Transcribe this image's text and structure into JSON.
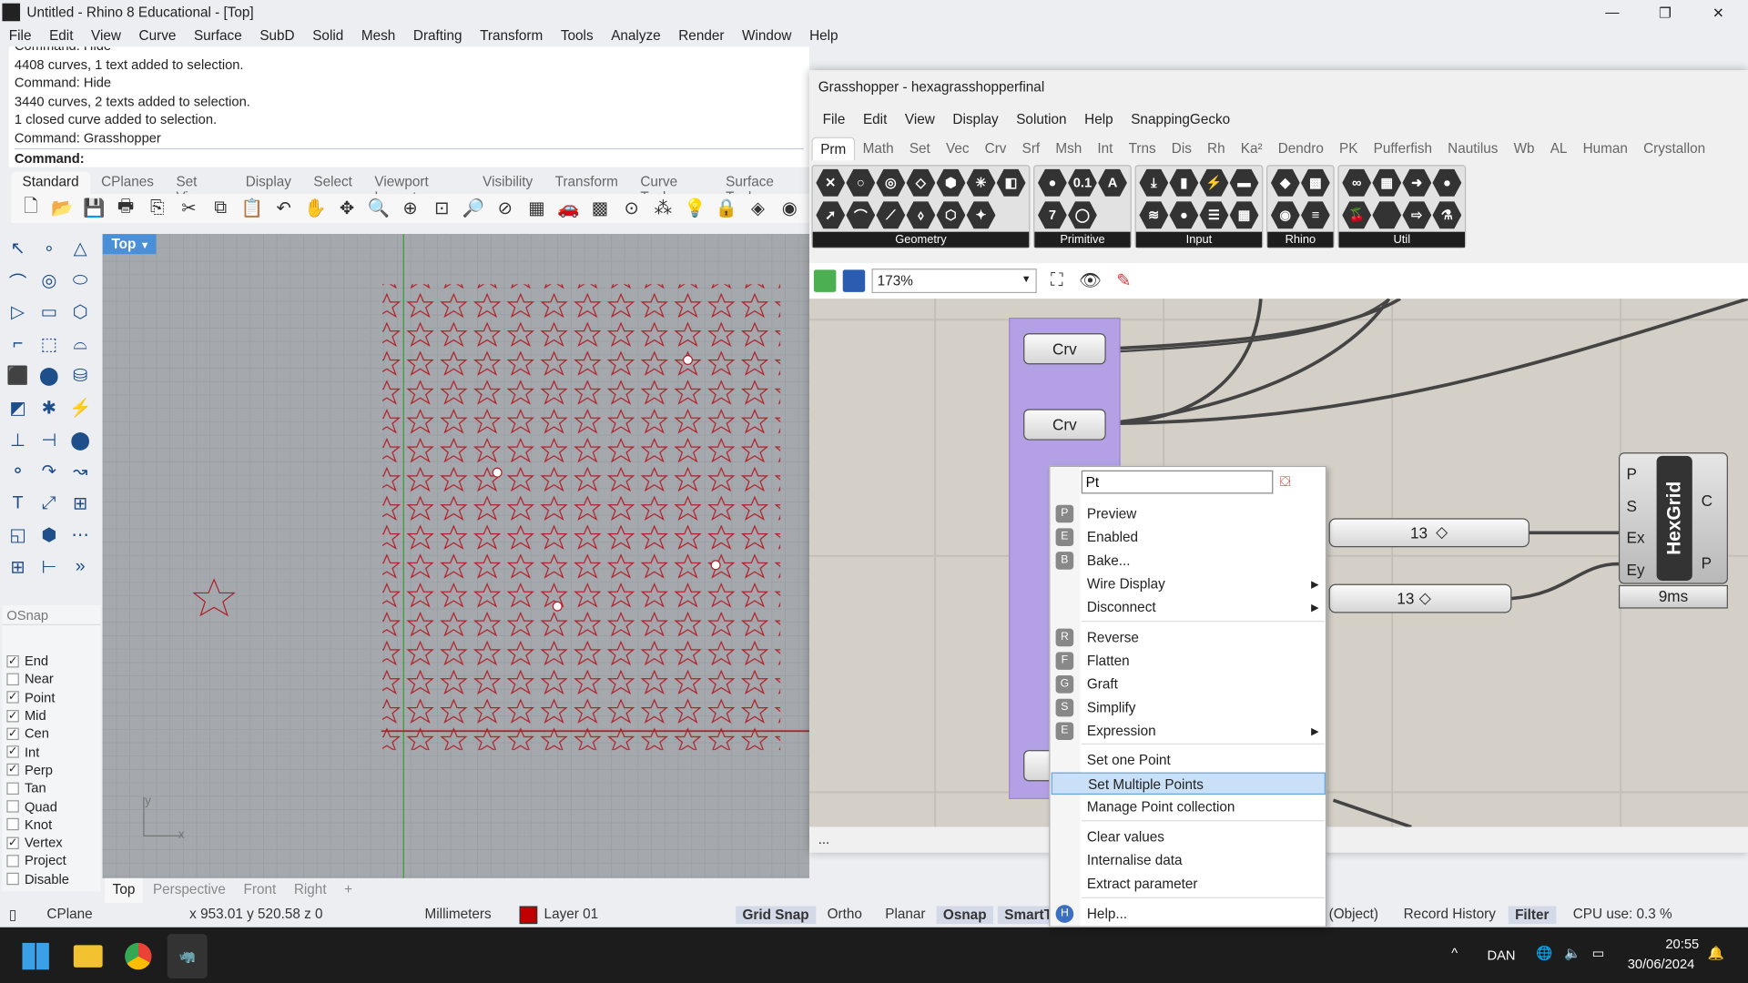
{
  "window": {
    "title": "Untitled - Rhino 8 Educational - [Top]"
  },
  "menu": [
    "File",
    "Edit",
    "View",
    "Curve",
    "Surface",
    "SubD",
    "Solid",
    "Mesh",
    "Drafting",
    "Transform",
    "Tools",
    "Analyze",
    "Render",
    "Window",
    "Help"
  ],
  "command_history": [
    "Command: Hide",
    "4408 curves, 1 text added to selection.",
    "Command: Hide",
    "3440 curves, 2 texts added to selection.",
    "1 closed curve added to selection.",
    "Command: Grasshopper"
  ],
  "command_prompt": "Command:",
  "toolbar_tabs": [
    "Standard",
    "CPlanes",
    "Set View",
    "Display",
    "Select",
    "Viewport Layout",
    "Visibility",
    "Transform",
    "Curve Tools",
    "Surface Tools"
  ],
  "toolbar_icons": [
    "new-file-icon",
    "open-icon",
    "save-icon",
    "print-icon",
    "export-icon",
    "cut-icon",
    "copy-icon",
    "paste-icon",
    "undo-icon",
    "pan-icon",
    "rotate-view-icon",
    "zoom-icon",
    "zoom-window-icon",
    "zoom-extents-icon",
    "zoom-selected-icon",
    "zoom-dynamic-icon",
    "four-view-icon",
    "car-icon",
    "grid-icon",
    "osnap-icon",
    "points-icon",
    "light-icon",
    "lock-icon",
    "material-icon",
    "color-wheel-icon"
  ],
  "toolbox_glyphs": [
    "↖",
    "∘",
    "△",
    "⌒",
    "◎",
    "⬭",
    "▷",
    "▭",
    "⬡",
    "⌐",
    "⬚",
    "⌓",
    "⬛",
    "⬤",
    "⛁",
    "◩",
    "✱",
    "⚡",
    "⊥",
    "⊣",
    "⬤",
    "⚬",
    "↷",
    "↝",
    "T",
    "⤢",
    "⊞",
    "◱",
    "⬢",
    "⋯",
    "⊞",
    "⊢",
    "»"
  ],
  "osnap": {
    "title": "OSnap",
    "items": [
      {
        "label": "End",
        "checked": true
      },
      {
        "label": "Near",
        "checked": false
      },
      {
        "label": "Point",
        "checked": true
      },
      {
        "label": "Mid",
        "checked": true
      },
      {
        "label": "Cen",
        "checked": true
      },
      {
        "label": "Int",
        "checked": true
      },
      {
        "label": "Perp",
        "checked": true
      },
      {
        "label": "Tan",
        "checked": false
      },
      {
        "label": "Quad",
        "checked": false
      },
      {
        "label": "Knot",
        "checked": false
      },
      {
        "label": "Vertex",
        "checked": true
      },
      {
        "label": "Project",
        "checked": false
      },
      {
        "label": "Disable",
        "checked": false
      }
    ]
  },
  "viewport": {
    "label": "Top",
    "axis_x": "x",
    "axis_y": "y"
  },
  "viewport_tabs": [
    "Top",
    "Perspective",
    "Front",
    "Right"
  ],
  "statusbar": {
    "cplane": "CPlane",
    "coords": "x 953.01  y 520.58  z 0",
    "units": "Millimeters",
    "layer": "Layer 01",
    "layer_color": "#c00000",
    "grid_snap": "Grid Snap",
    "ortho": "Ortho",
    "planar": "Planar",
    "osnap": "Osnap",
    "smart": "SmartTrack",
    "object": "(Object)",
    "record_history": "Record History",
    "filter": "Filter",
    "cpu": "CPU use: 0.3 %"
  },
  "taskbar": {
    "lang": "DAN",
    "time": "20:55",
    "date": "30/06/2024"
  },
  "grasshopper": {
    "title": "Grasshopper - hexagrasshopperfinal",
    "menu": [
      "File",
      "Edit",
      "View",
      "Display",
      "Solution",
      "Help",
      "SnappingGecko"
    ],
    "tabs": [
      "Prm",
      "Math",
      "Set",
      "Vec",
      "Crv",
      "Srf",
      "Msh",
      "Int",
      "Trns",
      "Dis",
      "Rh",
      "Ka²",
      "Dendro",
      "PK",
      "Pufferfish",
      "Nautilus",
      "Wb",
      "AL",
      "Human",
      "Crystallon"
    ],
    "groups": [
      {
        "label": "Geometry",
        "glyphs": [
          "✕",
          "➚",
          "○",
          "⌒",
          "◎",
          "⟋",
          "◇",
          "⬨",
          "⬢",
          "⬡",
          "✳",
          "✦",
          "◧"
        ]
      },
      {
        "label": "Primitive",
        "glyphs": [
          "●",
          "7",
          "0.1",
          "◯",
          "A"
        ]
      },
      {
        "label": "Input",
        "glyphs": [
          "⤓",
          "≋",
          "▮",
          "●",
          "⚡",
          "☰",
          "▬",
          "▦"
        ]
      },
      {
        "label": "Rhino",
        "glyphs": [
          "◆",
          "◉",
          "▩",
          "≡"
        ]
      },
      {
        "label": "Util",
        "glyphs": [
          "∞",
          "🍒",
          "▦",
          "",
          "➜",
          "⇨",
          "●",
          "⚗"
        ]
      }
    ],
    "zoom": "173%",
    "params": [
      {
        "label": "Crv"
      },
      {
        "label": "Crv"
      }
    ],
    "sliders": [
      {
        "value": "13"
      },
      {
        "value": "13"
      }
    ],
    "component": {
      "name": "HexGrid",
      "inputs": [
        "P",
        "S",
        "Ex",
        "Ey"
      ],
      "outputs": [
        "C",
        "P"
      ],
      "time": "9ms"
    },
    "status": "..."
  },
  "context_menu": {
    "search_value": "Pt",
    "items": [
      {
        "label": "Preview",
        "icon": "preview-icon"
      },
      {
        "label": "Enabled",
        "icon": "enabled-icon"
      },
      {
        "label": "Bake...",
        "icon": "bake-icon"
      },
      {
        "label": "Wire Display",
        "submenu": true
      },
      {
        "label": "Disconnect",
        "submenu": true
      },
      {
        "label": "Reverse",
        "icon": "reverse-icon"
      },
      {
        "label": "Flatten",
        "icon": "flatten-icon"
      },
      {
        "label": "Graft",
        "icon": "graft-icon"
      },
      {
        "label": "Simplify",
        "icon": "simplify-icon"
      },
      {
        "label": "Expression",
        "icon": "expression-icon",
        "submenu": true
      },
      {
        "label": "Set one Point"
      },
      {
        "label": "Set Multiple Points",
        "highlighted": true
      },
      {
        "label": "Manage Point collection"
      },
      {
        "label": "Clear values"
      },
      {
        "label": "Internalise data"
      },
      {
        "label": "Extract parameter"
      },
      {
        "label": "Help...",
        "icon": "help-icon"
      }
    ]
  }
}
